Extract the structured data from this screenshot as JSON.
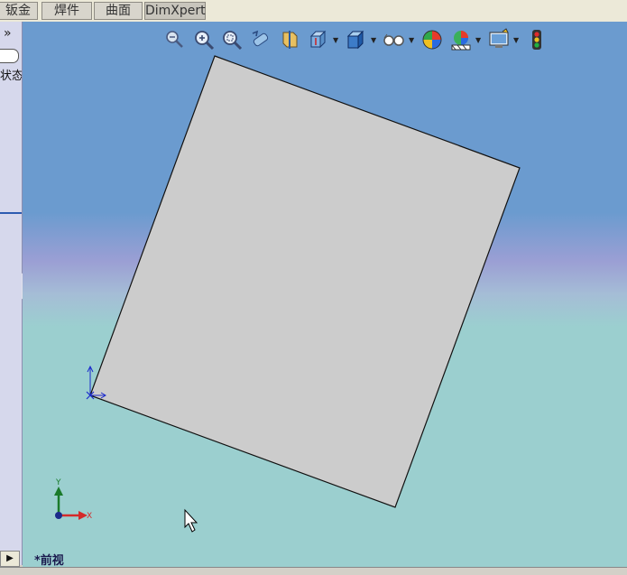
{
  "tabs": [
    "钣金",
    "焊件",
    "曲面",
    "DimXpert"
  ],
  "left_panel": {
    "expand_glyph": "»",
    "label": "状态"
  },
  "view_toolbar": {
    "icons": [
      "zoom-to-fit-icon",
      "zoom-in-icon",
      "zoom-to-area-icon",
      "previous-view-icon",
      "section-view-icon",
      "view-orientation-icon",
      "display-style-icon",
      "hide-show-items-icon",
      "edit-appearance-icon",
      "apply-scene-icon",
      "view-settings-icon",
      "performance-indicator-icon"
    ]
  },
  "triad": {
    "x_label": "X",
    "y_label": "Y"
  },
  "view_name": "*前视",
  "colors": {
    "viewport_top": "#6b9bcf",
    "viewport_bottom": "#9bcfcf",
    "face": "#cccccc",
    "edge": "#111111"
  }
}
